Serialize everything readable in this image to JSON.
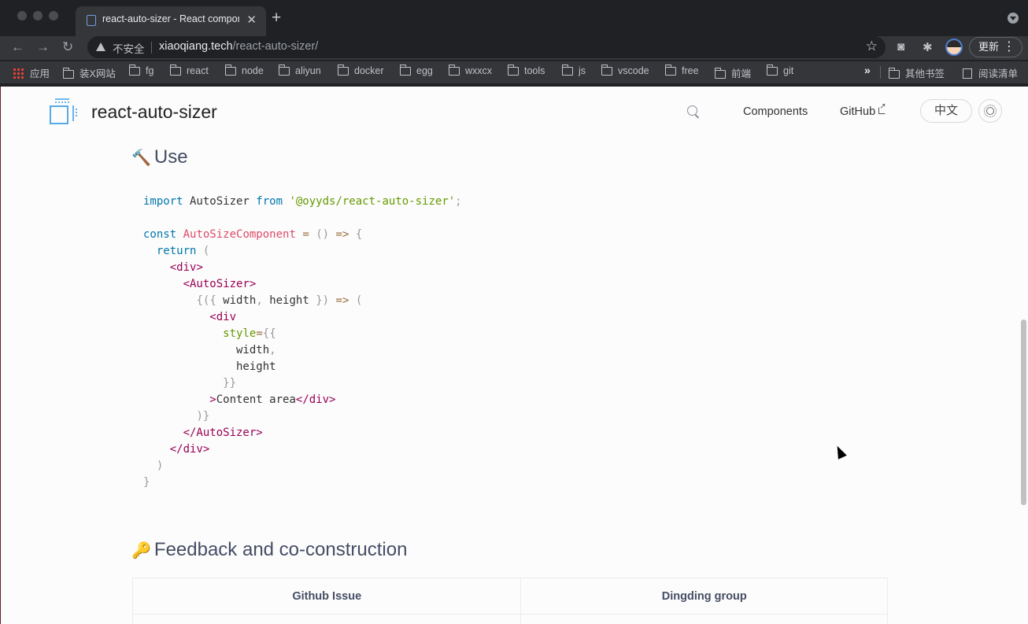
{
  "browser": {
    "tab_title": "react-auto-sizer - React components",
    "tab_close": "✕",
    "new_tab": "+",
    "insecure_label": "不安全",
    "url_host": "xiaoqiang.tech",
    "url_path": "/react-auto-sizer/",
    "update_label": "更新",
    "bookmarks": [
      "应用",
      "装X网站",
      "fg",
      "react",
      "node",
      "aliyun",
      "docker",
      "egg",
      "wxxcx",
      "tools",
      "js",
      "vscode",
      "free",
      "前端",
      "git"
    ],
    "more_bookmarks": "»",
    "other_bookmarks": "其他书签",
    "reading_list": "阅读清单",
    "icons": [
      "back-icon",
      "forward-icon",
      "reload-icon",
      "warning-icon",
      "star-icon",
      "camera-icon",
      "puzzle-icon",
      "menu-icon"
    ]
  },
  "site": {
    "title": "react-auto-sizer",
    "nav": {
      "components": "Components",
      "github": "GitHub"
    },
    "lang_button": "中文"
  },
  "content": {
    "use_heading": "Use",
    "use_emoji": "🔨",
    "feedback_heading": "Feedback and co-construction",
    "feedback_emoji": "🔑",
    "table_headers": [
      "Github Issue",
      "Dingding group"
    ]
  },
  "code_lines": [
    "import AutoSizer from '@oyyds/react-auto-sizer';",
    "",
    "const AutoSizeComponent = () => {",
    "  return (",
    "    <div>",
    "      <AutoSizer>",
    "        {({ width, height }) => (",
    "          <div",
    "            style={{",
    "              width,",
    "              height",
    "            }}",
    "          >Content area</div>",
    "        )}",
    "      </AutoSizer>",
    "    </div>",
    "  )",
    "}"
  ]
}
